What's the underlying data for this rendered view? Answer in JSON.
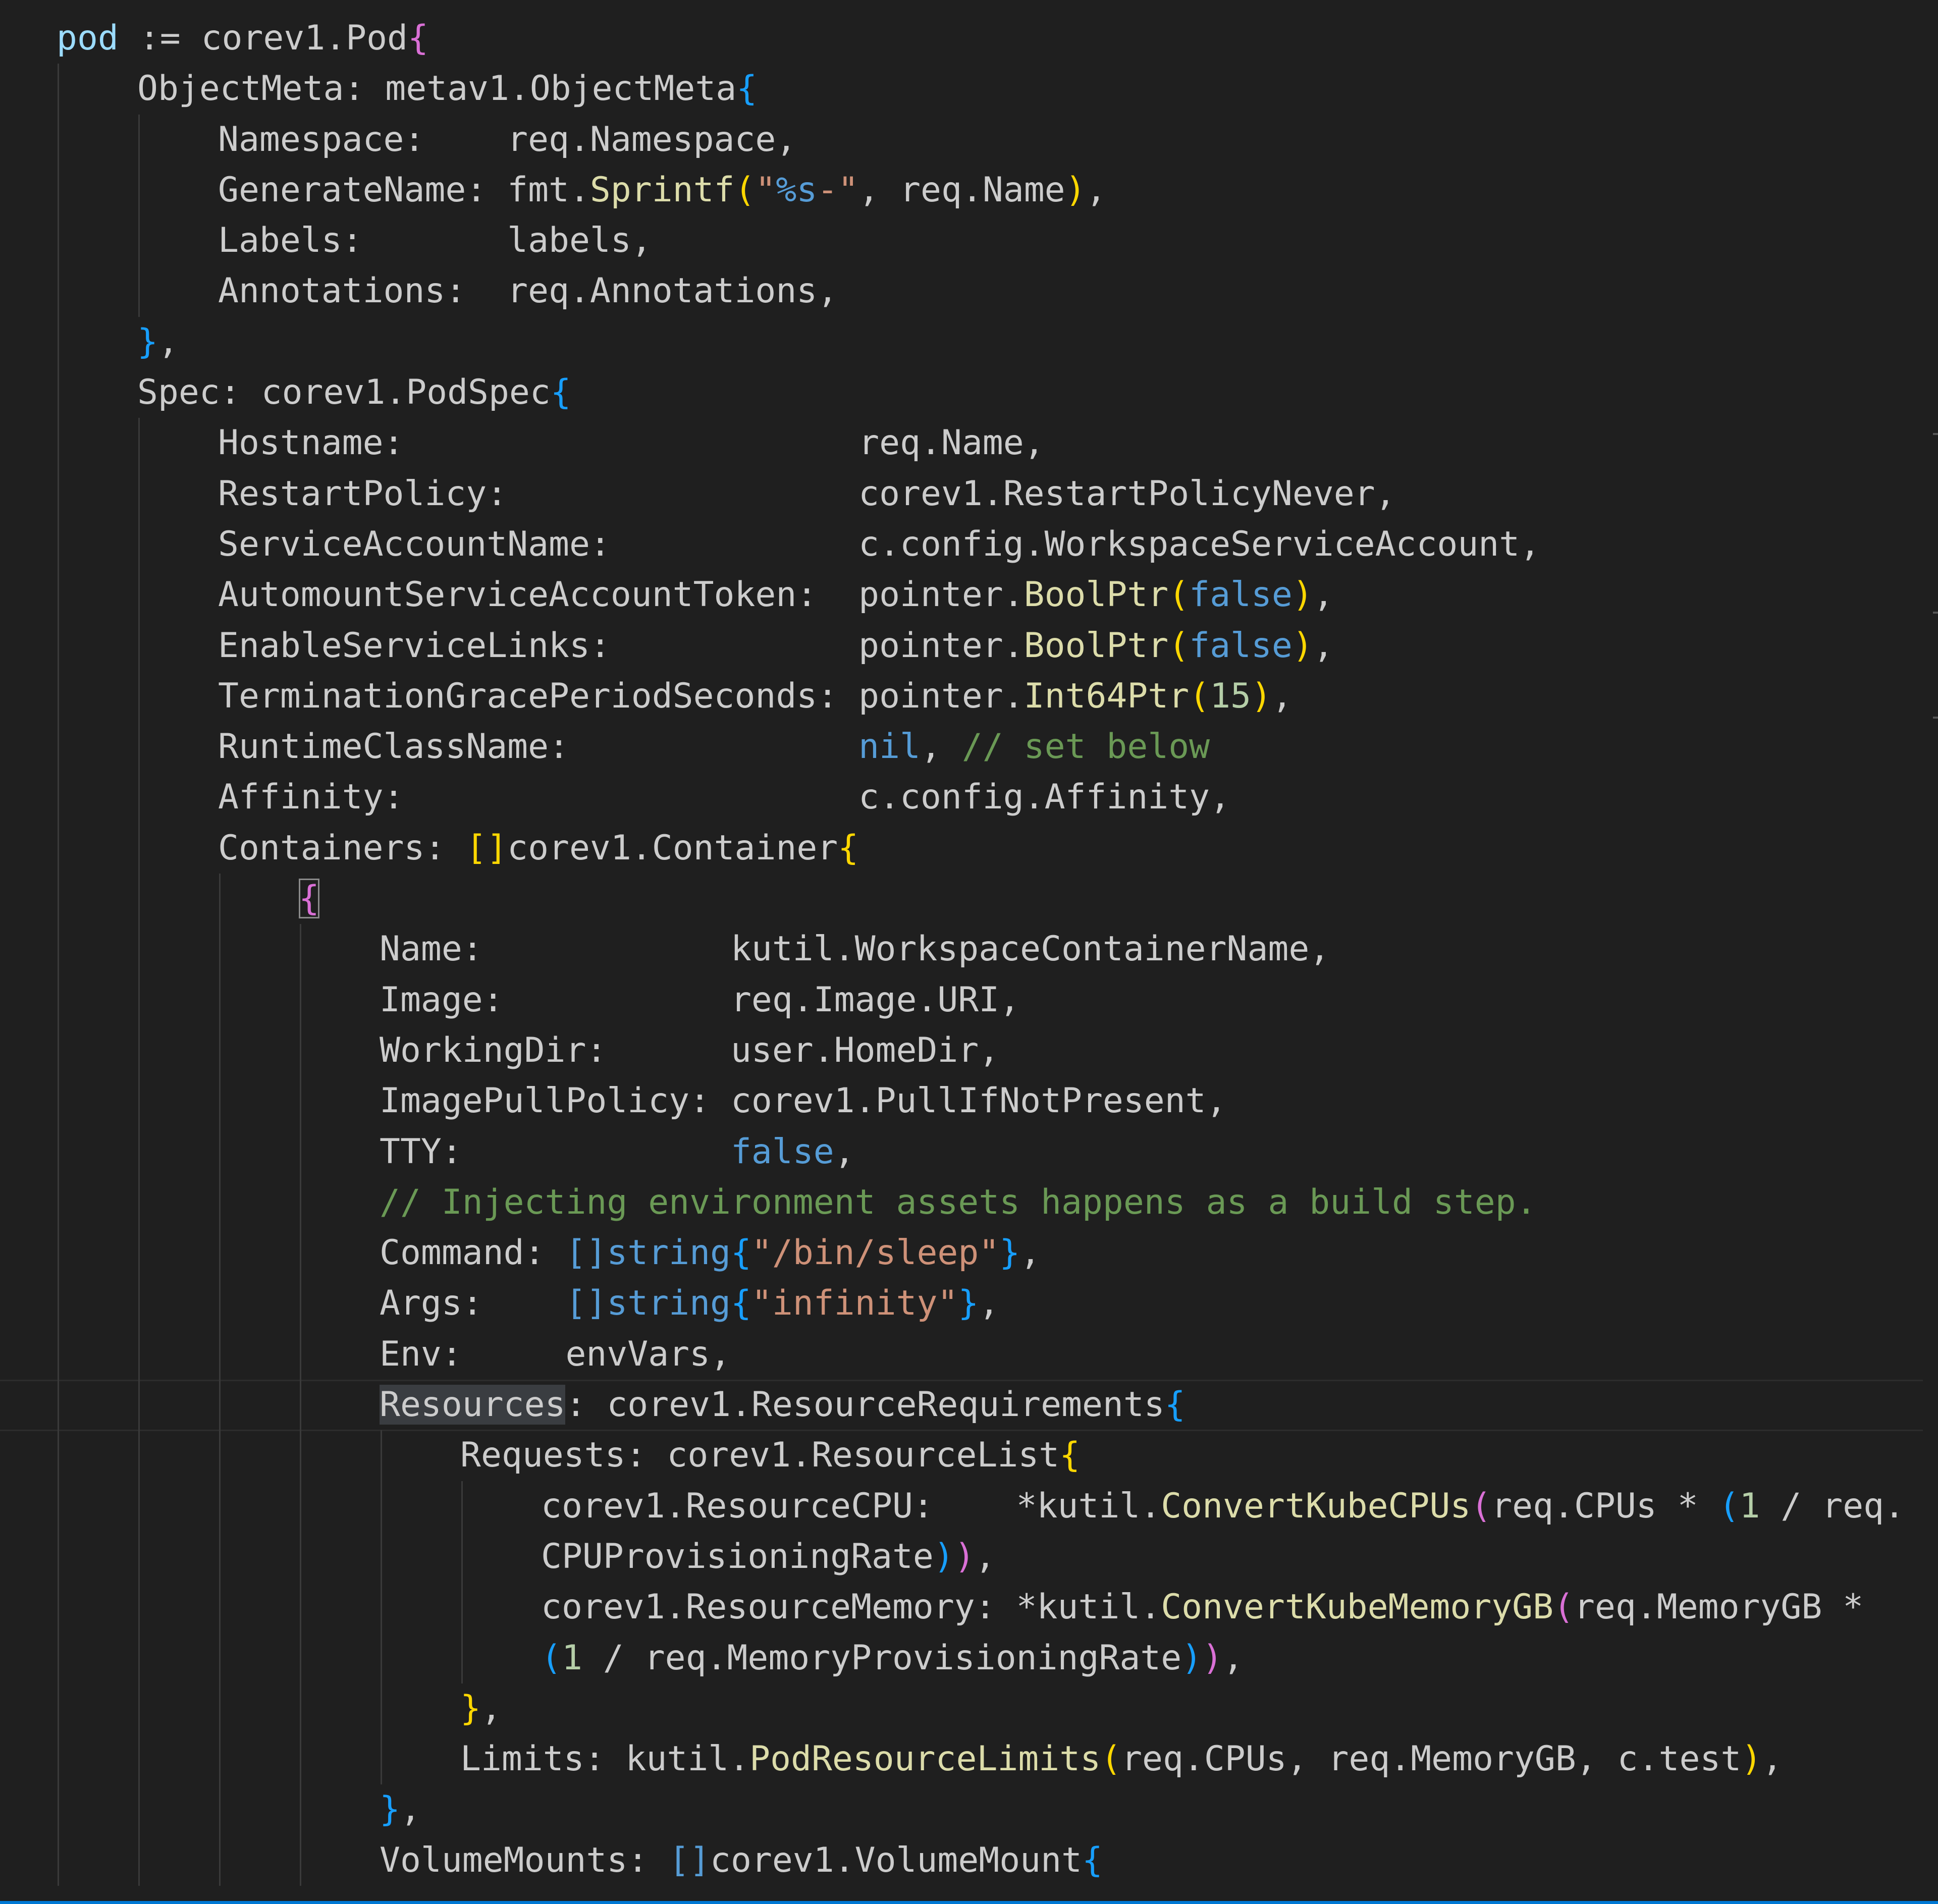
{
  "colors": {
    "background": "#1f1f1f",
    "text": "#cccccc",
    "keyword": "#569cd6",
    "function": "#dcdcaa",
    "string": "#ce9178",
    "comment": "#6a9955",
    "number": "#b5cea8",
    "bracket_gold": "#ffd700",
    "bracket_purple": "#da70d6",
    "bracket_blue": "#179fff",
    "variable": "#9cdcfe"
  },
  "editor": {
    "language": "Go",
    "active_line": 27,
    "lines": [
      {
        "indent": 0,
        "tokens": [
          {
            "t": "pod",
            "c": "variable"
          },
          {
            "t": " := corev1.Pod",
            "c": "text"
          },
          {
            "t": "{",
            "c": "bracket_purple"
          }
        ]
      },
      {
        "indent": 1,
        "tokens": [
          {
            "t": "ObjectMeta: metav1.ObjectMeta",
            "c": "text"
          },
          {
            "t": "{",
            "c": "bracket_blue"
          }
        ]
      },
      {
        "indent": 2,
        "tokens": [
          {
            "t": "Namespace:    req.Namespace,",
            "c": "text"
          }
        ]
      },
      {
        "indent": 2,
        "tokens": [
          {
            "t": "GenerateName: fmt.",
            "c": "text"
          },
          {
            "t": "Sprintf",
            "c": "function"
          },
          {
            "t": "(",
            "c": "bracket_gold"
          },
          {
            "t": "\"",
            "c": "string"
          },
          {
            "t": "%s",
            "c": "keyword"
          },
          {
            "t": "-\"",
            "c": "string"
          },
          {
            "t": ", req.Name",
            "c": "text"
          },
          {
            "t": ")",
            "c": "bracket_gold"
          },
          {
            "t": ",",
            "c": "text"
          }
        ]
      },
      {
        "indent": 2,
        "tokens": [
          {
            "t": "Labels:       labels,",
            "c": "text"
          }
        ]
      },
      {
        "indent": 2,
        "tokens": [
          {
            "t": "Annotations:  req.Annotations,",
            "c": "text"
          }
        ]
      },
      {
        "indent": 1,
        "tokens": [
          {
            "t": "}",
            "c": "bracket_blue"
          },
          {
            "t": ",",
            "c": "text"
          }
        ]
      },
      {
        "indent": 1,
        "tokens": [
          {
            "t": "Spec: corev1.PodSpec",
            "c": "text"
          },
          {
            "t": "{",
            "c": "bracket_blue"
          }
        ]
      },
      {
        "indent": 2,
        "tokens": [
          {
            "t": "Hostname:                      req.Name,",
            "c": "text"
          }
        ]
      },
      {
        "indent": 2,
        "tokens": [
          {
            "t": "RestartPolicy:                 corev1.RestartPolicyNever,",
            "c": "text"
          }
        ]
      },
      {
        "indent": 2,
        "tokens": [
          {
            "t": "ServiceAccountName:            c.config.WorkspaceServiceAccount,",
            "c": "text"
          }
        ]
      },
      {
        "indent": 2,
        "tokens": [
          {
            "t": "AutomountServiceAccountToken:  pointer.",
            "c": "text"
          },
          {
            "t": "BoolPtr",
            "c": "function"
          },
          {
            "t": "(",
            "c": "bracket_gold"
          },
          {
            "t": "false",
            "c": "keyword"
          },
          {
            "t": ")",
            "c": "bracket_gold"
          },
          {
            "t": ",",
            "c": "text"
          }
        ]
      },
      {
        "indent": 2,
        "tokens": [
          {
            "t": "EnableServiceLinks:            pointer.",
            "c": "text"
          },
          {
            "t": "BoolPtr",
            "c": "function"
          },
          {
            "t": "(",
            "c": "bracket_gold"
          },
          {
            "t": "false",
            "c": "keyword"
          },
          {
            "t": ")",
            "c": "bracket_gold"
          },
          {
            "t": ",",
            "c": "text"
          }
        ]
      },
      {
        "indent": 2,
        "tokens": [
          {
            "t": "TerminationGracePeriodSeconds: pointer.",
            "c": "text"
          },
          {
            "t": "Int64Ptr",
            "c": "function"
          },
          {
            "t": "(",
            "c": "bracket_gold"
          },
          {
            "t": "15",
            "c": "number"
          },
          {
            "t": ")",
            "c": "bracket_gold"
          },
          {
            "t": ",",
            "c": "text"
          }
        ]
      },
      {
        "indent": 2,
        "tokens": [
          {
            "t": "RuntimeClassName:              ",
            "c": "text"
          },
          {
            "t": "nil",
            "c": "keyword"
          },
          {
            "t": ", ",
            "c": "text"
          },
          {
            "t": "// set below",
            "c": "comment"
          }
        ]
      },
      {
        "indent": 2,
        "tokens": [
          {
            "t": "Affinity:                      c.config.Affinity,",
            "c": "text"
          }
        ]
      },
      {
        "indent": 2,
        "tokens": [
          {
            "t": "Containers: ",
            "c": "text"
          },
          {
            "t": "[]",
            "c": "bracket_gold"
          },
          {
            "t": "corev1.Container",
            "c": "text"
          },
          {
            "t": "{",
            "c": "bracket_gold"
          }
        ]
      },
      {
        "indent": 3,
        "tokens": [
          {
            "t": "{",
            "c": "bracket_purple",
            "box": true
          }
        ]
      },
      {
        "indent": 4,
        "tokens": [
          {
            "t": "Name:            kutil.WorkspaceContainerName,",
            "c": "text"
          }
        ]
      },
      {
        "indent": 4,
        "tokens": [
          {
            "t": "Image:           req.Image.URI,",
            "c": "text"
          }
        ]
      },
      {
        "indent": 4,
        "tokens": [
          {
            "t": "WorkingDir:      user.HomeDir,",
            "c": "text"
          }
        ]
      },
      {
        "indent": 4,
        "tokens": [
          {
            "t": "ImagePullPolicy: corev1.PullIfNotPresent,",
            "c": "text"
          }
        ]
      },
      {
        "indent": 4,
        "tokens": [
          {
            "t": "TTY:             ",
            "c": "text"
          },
          {
            "t": "false",
            "c": "keyword"
          },
          {
            "t": ",",
            "c": "text"
          }
        ]
      },
      {
        "indent": 4,
        "tokens": [
          {
            "t": "// Injecting environment assets happens as a build step.",
            "c": "comment"
          }
        ]
      },
      {
        "indent": 4,
        "tokens": [
          {
            "t": "Command: ",
            "c": "text"
          },
          {
            "t": "[]string",
            "c": "keyword"
          },
          {
            "t": "{",
            "c": "bracket_blue"
          },
          {
            "t": "\"/bin/sleep\"",
            "c": "string"
          },
          {
            "t": "}",
            "c": "bracket_blue"
          },
          {
            "t": ",",
            "c": "text"
          }
        ]
      },
      {
        "indent": 4,
        "tokens": [
          {
            "t": "Args:    ",
            "c": "text"
          },
          {
            "t": "[]string",
            "c": "keyword"
          },
          {
            "t": "{",
            "c": "bracket_blue"
          },
          {
            "t": "\"infinity\"",
            "c": "string"
          },
          {
            "t": "}",
            "c": "bracket_blue"
          },
          {
            "t": ",",
            "c": "text"
          }
        ]
      },
      {
        "indent": 4,
        "tokens": [
          {
            "t": "Env:     envVars,",
            "c": "text"
          }
        ]
      },
      {
        "indent": 4,
        "tokens": [
          {
            "t": "Resources",
            "c": "text",
            "hl": true
          },
          {
            "t": ": corev1.ResourceRequirements",
            "c": "text"
          },
          {
            "t": "{",
            "c": "bracket_blue"
          }
        ]
      },
      {
        "indent": 5,
        "tokens": [
          {
            "t": "Requests: corev1.ResourceList",
            "c": "text"
          },
          {
            "t": "{",
            "c": "bracket_gold"
          }
        ]
      },
      {
        "indent": 6,
        "tokens": [
          {
            "t": "corev1.ResourceCPU:    *kutil.",
            "c": "text"
          },
          {
            "t": "ConvertKubeCPUs",
            "c": "function"
          },
          {
            "t": "(",
            "c": "bracket_purple"
          },
          {
            "t": "req.CPUs * ",
            "c": "text"
          },
          {
            "t": "(",
            "c": "bracket_blue"
          },
          {
            "t": "1",
            "c": "number"
          },
          {
            "t": " / req.",
            "c": "text"
          }
        ]
      },
      {
        "indent": 6,
        "tokens": [
          {
            "t": "CPUProvisioningRate",
            "c": "text"
          },
          {
            "t": ")",
            "c": "bracket_blue"
          },
          {
            "t": ")",
            "c": "bracket_purple"
          },
          {
            "t": ",",
            "c": "text"
          }
        ]
      },
      {
        "indent": 6,
        "tokens": [
          {
            "t": "corev1.ResourceMemory: *kutil.",
            "c": "text"
          },
          {
            "t": "ConvertKubeMemoryGB",
            "c": "function"
          },
          {
            "t": "(",
            "c": "bracket_purple"
          },
          {
            "t": "req.MemoryGB *",
            "c": "text"
          }
        ]
      },
      {
        "indent": 6,
        "tokens": [
          {
            "t": "(",
            "c": "bracket_blue"
          },
          {
            "t": "1",
            "c": "number"
          },
          {
            "t": " / req.MemoryProvisioningRate",
            "c": "text"
          },
          {
            "t": ")",
            "c": "bracket_blue"
          },
          {
            "t": ")",
            "c": "bracket_purple"
          },
          {
            "t": ",",
            "c": "text"
          }
        ]
      },
      {
        "indent": 5,
        "tokens": [
          {
            "t": "}",
            "c": "bracket_gold"
          },
          {
            "t": ",",
            "c": "text"
          }
        ]
      },
      {
        "indent": 5,
        "tokens": [
          {
            "t": "Limits: kutil.",
            "c": "text"
          },
          {
            "t": "PodResourceLimits",
            "c": "function"
          },
          {
            "t": "(",
            "c": "bracket_gold"
          },
          {
            "t": "req.CPUs, req.MemoryGB, c.test",
            "c": "text"
          },
          {
            "t": ")",
            "c": "bracket_gold"
          },
          {
            "t": ",",
            "c": "text"
          }
        ]
      },
      {
        "indent": 4,
        "tokens": [
          {
            "t": "}",
            "c": "bracket_blue"
          },
          {
            "t": ",",
            "c": "text"
          }
        ]
      },
      {
        "indent": 4,
        "tokens": [
          {
            "t": "VolumeMounts: ",
            "c": "text"
          },
          {
            "t": "[]",
            "c": "keyword"
          },
          {
            "t": "corev1.VolumeMount",
            "c": "text"
          },
          {
            "t": "{",
            "c": "bracket_blue"
          }
        ]
      }
    ]
  }
}
